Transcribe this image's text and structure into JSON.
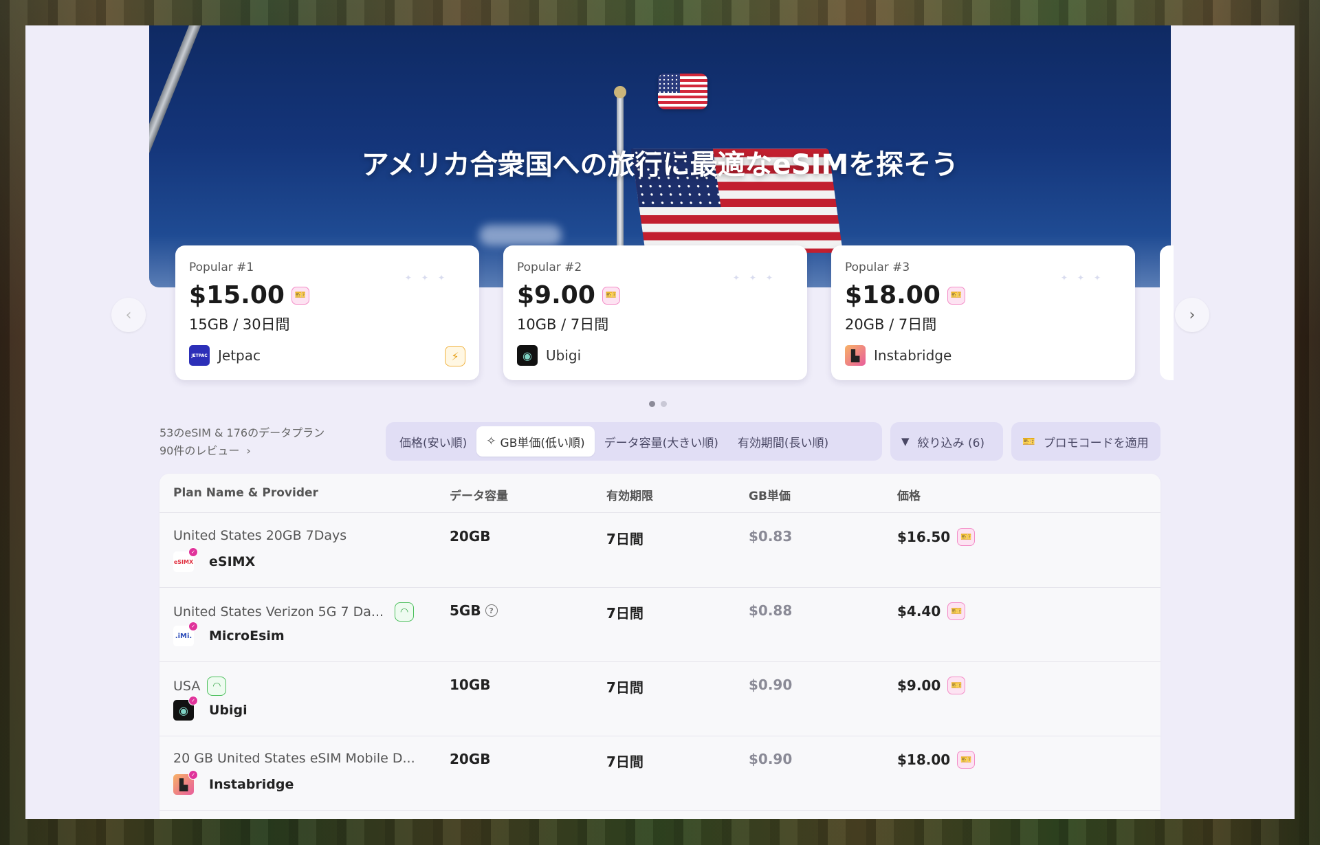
{
  "hero": {
    "title": "アメリカ合衆国への旅行に最適なeSIMを探そう",
    "flag_icon": "us-flag-icon"
  },
  "carousel": {
    "prev_icon": "‹",
    "next_icon": "›",
    "cards": [
      {
        "rank": "Popular #1",
        "price": "$15.00",
        "plan": "15GB / 30日間",
        "provider": "Jetpac",
        "logo_text": "JETPAC",
        "has_bolt": true
      },
      {
        "rank": "Popular #2",
        "price": "$9.00",
        "plan": "10GB / 7日間",
        "provider": "Ubigi",
        "logo_text": "◉",
        "has_bolt": false
      },
      {
        "rank": "Popular #3",
        "price": "$18.00",
        "plan": "20GB / 7日間",
        "provider": "Instabridge",
        "logo_text": "▙",
        "has_bolt": false
      }
    ],
    "page_count": 2,
    "active_page": 1
  },
  "summary": {
    "counts": "53のeSIM & 176のデータプラン",
    "reviews": "90件のレビュー",
    "reviews_chevron": "›"
  },
  "sort": {
    "tabs": [
      {
        "label": "価格(安い順)",
        "active": false
      },
      {
        "label": "GB単価(低い順)",
        "active": true
      },
      {
        "label": "データ容量(大きい順)",
        "active": false
      },
      {
        "label": "有効期間(長い順)",
        "active": false
      }
    ],
    "filter_label": "絞り込み (6)",
    "promo_label": "プロモコードを適用"
  },
  "table": {
    "headers": {
      "plan": "Plan Name & Provider",
      "data": "データ容量",
      "validity": "有効期限",
      "per_gb": "GB単価",
      "price": "価格"
    },
    "rows": [
      {
        "plan": "United States 20GB 7Days",
        "provider": "eSIMX",
        "logo_text": "eSIMX",
        "data": "20GB",
        "validity": "7日間",
        "per_gb": "$0.83",
        "price": "$16.50",
        "signal": false,
        "info": false
      },
      {
        "plan": "United States Verizon 5G 7 Da...",
        "provider": "MicroEsim",
        "logo_text": ".iMi.",
        "data": "5GB",
        "validity": "7日間",
        "per_gb": "$0.88",
        "price": "$4.40",
        "signal": true,
        "info": true
      },
      {
        "plan": "USA",
        "provider": "Ubigi",
        "logo_text": "◉",
        "data": "10GB",
        "validity": "7日間",
        "per_gb": "$0.90",
        "price": "$9.00",
        "signal": true,
        "info": false
      },
      {
        "plan": "20 GB United States eSIM Mobile D...",
        "provider": "Instabridge",
        "logo_text": "▙",
        "data": "20GB",
        "validity": "7日間",
        "per_gb": "$0.90",
        "price": "$18.00",
        "signal": false,
        "info": false
      }
    ]
  }
}
